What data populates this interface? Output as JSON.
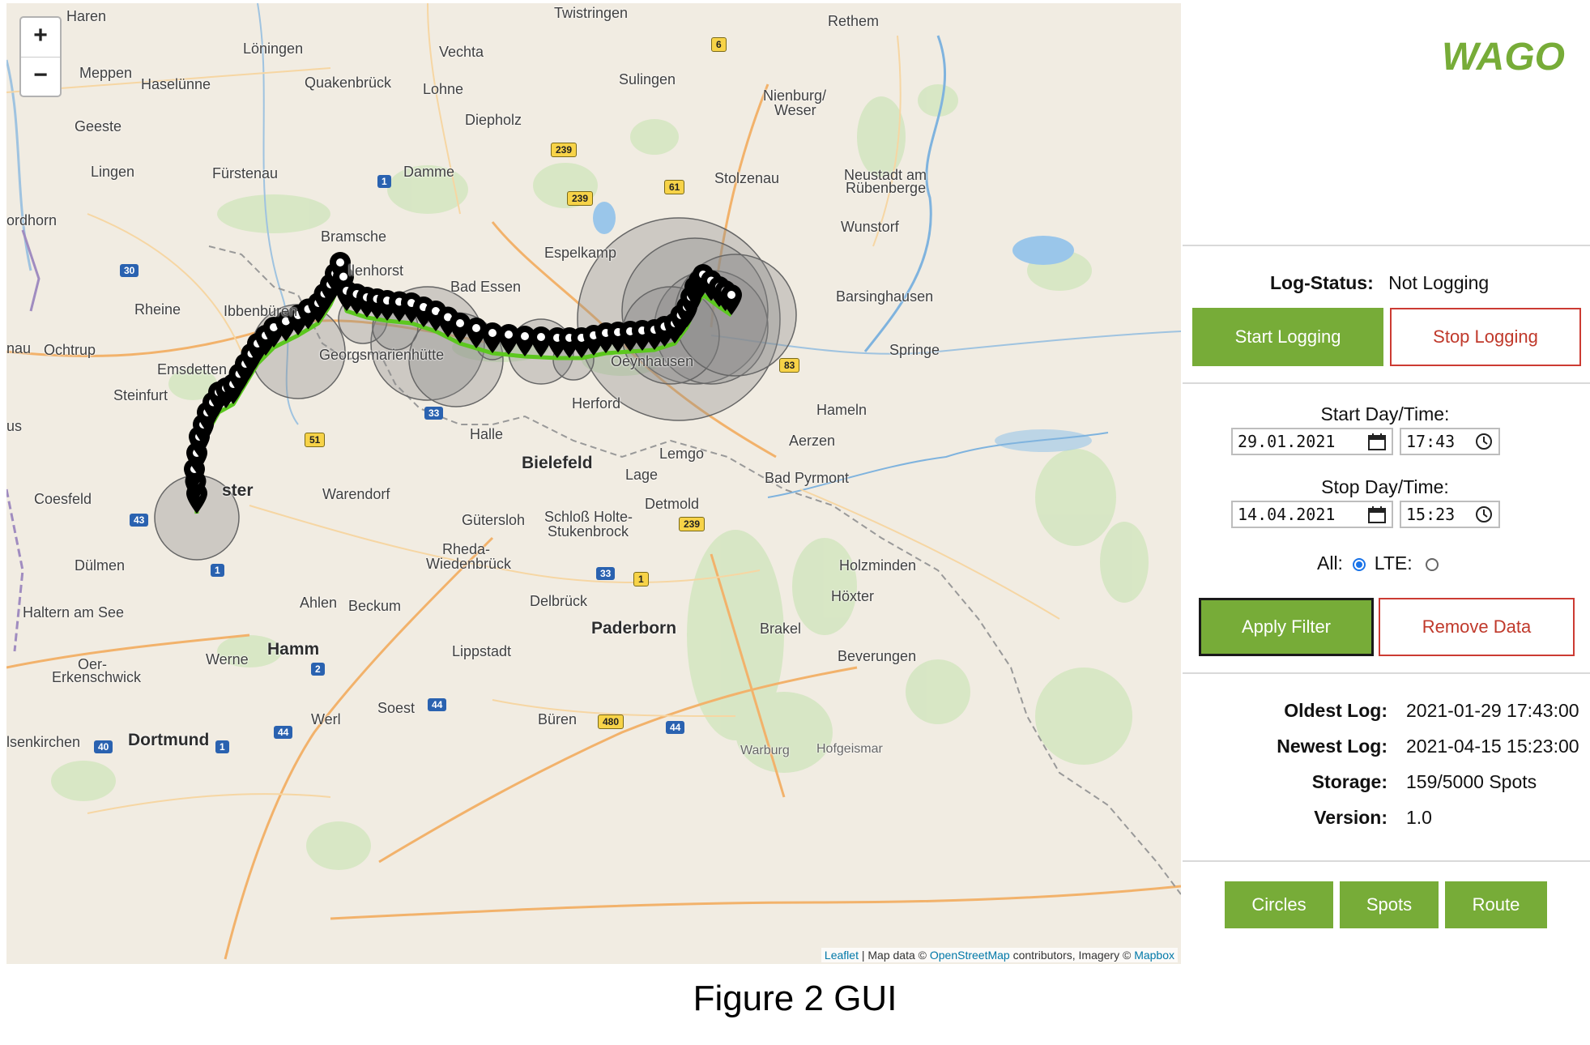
{
  "map": {
    "zoom_in": "+",
    "zoom_out": "−",
    "places": {
      "haren": "Haren",
      "twistringen": "Twistringen",
      "rethem": "Rethem",
      "loningen": "Löningen",
      "vechta": "Vechta",
      "meppen": "Meppen",
      "haselunne": "Haselünne",
      "quakenbruck": "Quakenbrück",
      "lohne": "Lohne",
      "sulingen": "Sulingen",
      "nienburg": "Nienburg/",
      "weser": "Weser",
      "geeste": "Geeste",
      "diepholz": "Diepholz",
      "lingen": "Lingen",
      "furstenau": "Fürstenau",
      "damme": "Damme",
      "stolzenau": "Stolzenau",
      "neustadt1": "Neustadt am",
      "neustadt2": "Rübenberge",
      "nordhorn": "ordhorn",
      "wunstorf": "Wunstorf",
      "bramsche": "Bramsche",
      "espelkamp": "Espelkamp",
      "hallenhorst": "llenhorst",
      "bad_essen": "Bad Essen",
      "barsinghausen": "Barsinghausen",
      "rheine": "Rheine",
      "ibbenburen": "Ibbenbüren",
      "nau": "nau",
      "ochtrup": "Ochtrup",
      "georgsmarienhutte": "Georgsmarienhütte",
      "oeynhausen": "Oeynhausen",
      "springe": "Springe",
      "emsdetten": "Emsdetten",
      "steinfurt": "Steinfurt",
      "herford": "Herford",
      "hameln": "Hameln",
      "us": "us",
      "halle": "Halle",
      "aerzen": "Aerzen",
      "lemgo": "Lemgo",
      "bielefeld": "Bielefeld",
      "lage": "Lage",
      "bad_pyrmont": "Bad Pyrmont",
      "munster": "ster",
      "coesfeld": "Coesfeld",
      "warendorf": "Warendorf",
      "detmold": "Detmold",
      "gutersloh": "Gütersloh",
      "schloss1": "Schloß Holte-",
      "schloss2": "Stukenbrock",
      "rheda1": "Rheda-",
      "rheda2": "Wiedenbrück",
      "dulmen": "Dülmen",
      "holzminden": "Holzminden",
      "haltern": "Haltern am See",
      "ahlen": "Ahlen",
      "beckum": "Beckum",
      "delbruck": "Delbrück",
      "hoxter": "Höxter",
      "paderborn": "Paderborn",
      "brakel": "Brakel",
      "hamm": "Hamm",
      "lippstadt": "Lippstadt",
      "oer1": "Oer-",
      "oer2": "Erkenschwick",
      "werne": "Werne",
      "beverungen": "Beverungen",
      "soest": "Soest",
      "werl": "Werl",
      "buren": "Büren",
      "senkirchen": "lsenkirchen",
      "dortmund": "Dortmund",
      "warburg": "Warburg",
      "hofgeismar": "Hofgeismar"
    },
    "roads": {
      "r6": "6",
      "r239a": "239",
      "r239b": "239",
      "r61": "61",
      "r1a": "1",
      "r30": "30",
      "r83": "83",
      "r33a": "33",
      "r51": "51",
      "r43": "43",
      "r239c": "239",
      "r1b": "1",
      "r33b": "33",
      "r1c": "1",
      "r2": "2",
      "r44a": "44",
      "r480": "480",
      "r44b": "44",
      "r44c": "44",
      "r40": "40",
      "r1d": "1"
    },
    "attribution": {
      "leaflet": "Leaflet",
      "sep": " | Map data © ",
      "osm": "OpenStreetMap",
      "mid": " contributors, Imagery © ",
      "mapbox": "Mapbox"
    },
    "colors": {
      "route": "#5cc71f",
      "marker": "#000000",
      "circle_fill": "#8a8a8a"
    }
  },
  "panel": {
    "logo": "WAGO",
    "log_status_label": "Log-Status:",
    "log_status_value": "Not Logging",
    "start_logging": "Start Logging",
    "stop_logging": "Stop Logging",
    "start_caption": "Start Day/Time:",
    "start_date": "29.01.2021",
    "start_time": "17:43",
    "stop_caption": "Stop Day/Time:",
    "stop_date": "14.04.2021",
    "stop_time": "15:23",
    "all_label": "All:",
    "lte_label": "LTE:",
    "selected_radio": "All",
    "apply_filter": "Apply Filter",
    "remove_data": "Remove Data",
    "oldest_label": "Oldest Log:",
    "oldest_value": "2021-01-29 17:43:00",
    "newest_label": "Newest Log:",
    "newest_value": "2021-04-15 15:23:00",
    "storage_label": "Storage:",
    "storage_value": "159/5000 Spots",
    "version_label": "Version:",
    "version_value": "1.0",
    "circles": "Circles",
    "spots": "Spots",
    "route": "Route",
    "accent_green": "#77ac38",
    "accent_red": "#cc3b33"
  },
  "caption": "Figure 2 GUI"
}
